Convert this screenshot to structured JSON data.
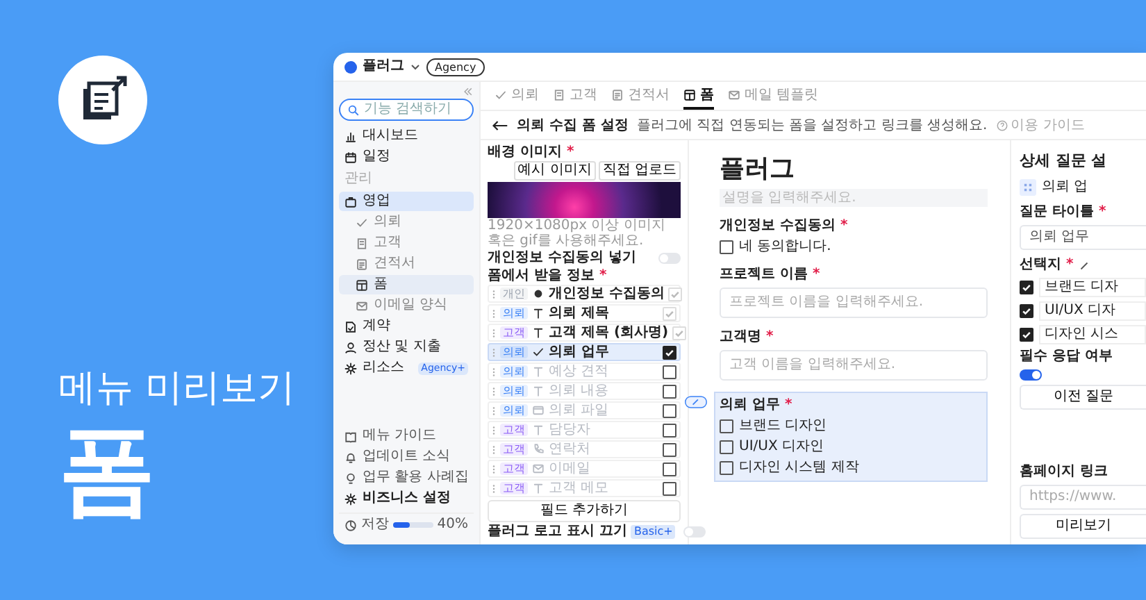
{
  "banner": {
    "heading": "메뉴 미리보기",
    "title": "폼"
  },
  "topbar": {
    "workspace": "플러그",
    "plan_badge": "Agency"
  },
  "sidebar": {
    "search_placeholder": "기능 검색하기",
    "items": [
      {
        "kind": "item",
        "label": "대시보드",
        "selected": false
      },
      {
        "kind": "item",
        "label": "일정",
        "selected": false
      },
      {
        "kind": "section",
        "label": "관리"
      },
      {
        "kind": "item",
        "label": "영업",
        "selected": true,
        "children": [
          {
            "label": "의뢰",
            "selected": false
          },
          {
            "label": "고객",
            "selected": false
          },
          {
            "label": "견적서",
            "selected": false
          },
          {
            "label": "폼",
            "selected": true
          },
          {
            "label": "이메일 양식",
            "selected": false
          }
        ]
      },
      {
        "kind": "item",
        "label": "계약",
        "selected": false
      },
      {
        "kind": "item",
        "label": "정산 및 지출",
        "selected": false
      },
      {
        "kind": "item",
        "label": "리소스",
        "selected": false,
        "badge": "Agency+"
      }
    ],
    "links": [
      {
        "label": "메뉴 가이드",
        "bold": false
      },
      {
        "label": "업데이트 소식",
        "bold": false
      },
      {
        "label": "업무 활용 사례집",
        "bold": false
      },
      {
        "label": "비즈니스 설정",
        "bold": true
      }
    ],
    "storage": {
      "label": "저장",
      "level": 0.4,
      "reading": "40%"
    }
  },
  "tabs": [
    {
      "label": "의뢰",
      "selected": false
    },
    {
      "label": "고객",
      "selected": false
    },
    {
      "label": "견적서",
      "selected": false
    },
    {
      "label": "폼",
      "selected": true
    },
    {
      "label": "메일 템플릿",
      "selected": false
    }
  ],
  "header": {
    "title": "의뢰 수집 폼 설정",
    "description": "플러그에 직접 연동되는 폼을 설정하고 링크를 생성해요.",
    "guide": "이용 가이드"
  },
  "settings": {
    "background_image": {
      "label": {
        "text": "배경 이미지",
        "mark": "*"
      },
      "buttons": [
        "예시 이미지",
        "직접 업로드"
      ],
      "caption": "1920×1080px 이상 이미지 혹은 gif를 사용해주세요."
    },
    "consent_toggle": {
      "label": "개인정보 수집동의 넣기",
      "on": false
    },
    "fields": {
      "label": {
        "text": "폼에서 받을 정보",
        "mark": "*"
      },
      "rows": [
        {
          "tag": "개인",
          "color": "#9ca3af",
          "label": "개인정보 수집동의",
          "checked": true,
          "locked": true,
          "selected": false
        },
        {
          "tag": "의뢰",
          "color": "#3b82f6",
          "label": "의뢰 제목",
          "checked": true,
          "locked": true,
          "selected": false
        },
        {
          "tag": "고객",
          "color": "#8b5cf6",
          "label": "고객 제목 (회사명)",
          "checked": true,
          "locked": true,
          "selected": false
        },
        {
          "tag": "의뢰",
          "color": "#3b82f6",
          "label": "의뢰 업무",
          "checked": true,
          "locked": false,
          "selected": true
        },
        {
          "tag": "의뢰",
          "color": "#3b82f6",
          "label": "예상 견적",
          "checked": false,
          "locked": false,
          "selected": false
        },
        {
          "tag": "의뢰",
          "color": "#3b82f6",
          "label": "의뢰 내용",
          "checked": false,
          "locked": false,
          "selected": false
        },
        {
          "tag": "의뢰",
          "color": "#3b82f6",
          "label": "의뢰 파일",
          "checked": false,
          "locked": false,
          "selected": false
        },
        {
          "tag": "고객",
          "color": "#8b5cf6",
          "label": "담당자",
          "checked": false,
          "locked": false,
          "selected": false
        },
        {
          "tag": "고객",
          "color": "#8b5cf6",
          "label": "연락처",
          "checked": false,
          "locked": false,
          "selected": false
        },
        {
          "tag": "고객",
          "color": "#8b5cf6",
          "label": "이메일",
          "checked": false,
          "locked": false,
          "selected": false
        },
        {
          "tag": "고객",
          "color": "#8b5cf6",
          "label": "고객 메모",
          "checked": false,
          "locked": false,
          "selected": false
        }
      ],
      "add_button": "필드 추가하기"
    },
    "logo_toggle": {
      "label": "플러그 로고 표시 끄기",
      "badge": "Basic+",
      "on": false
    }
  },
  "preview": {
    "title": "플러그",
    "description_placeholder": "설명을 입력해주세요.",
    "questions": [
      {
        "kind": "checkbox",
        "label": {
          "text": "개인정보 수집동의",
          "mark": "*"
        },
        "selected": false,
        "options": [
          {
            "label": "네 동의합니다.",
            "checked": false
          }
        ]
      },
      {
        "kind": "text",
        "label": {
          "text": "프로젝트 이름",
          "mark": "*"
        },
        "selected": false,
        "placeholder": "프로젝트 이름을 입력해주세요."
      },
      {
        "kind": "text",
        "label": {
          "text": "고객명",
          "mark": "*"
        },
        "selected": false,
        "placeholder": "고객 이름을 입력해주세요."
      },
      {
        "kind": "checkbox",
        "label": {
          "text": "의뢰 업무",
          "mark": "*"
        },
        "selected": true,
        "options": [
          {
            "label": "브랜드 디자인",
            "checked": false
          },
          {
            "label": "UI/UX 디자인",
            "checked": false
          },
          {
            "label": "디자인 시스템 제작",
            "checked": false
          }
        ]
      }
    ]
  },
  "detail": {
    "title": "상세 질문 설",
    "chip": "의뢰 업",
    "title_label": {
      "text": "질문 타이틀",
      "mark": "*"
    },
    "title_value": "의뢰 업무",
    "choices_label": {
      "text": "선택지",
      "mark": "*"
    },
    "choices": [
      {
        "label": "브랜드 디자",
        "checked": true
      },
      {
        "label": "UI/UX 디자",
        "checked": true
      },
      {
        "label": "디자인 시스",
        "checked": true
      }
    ],
    "required_label": "필수 응답 여부",
    "required_on": true,
    "prev_button": "이전 질문",
    "homepage_label": "홈페이지 링크",
    "homepage_placeholder": "https://www.",
    "preview_button": "미리보기"
  }
}
